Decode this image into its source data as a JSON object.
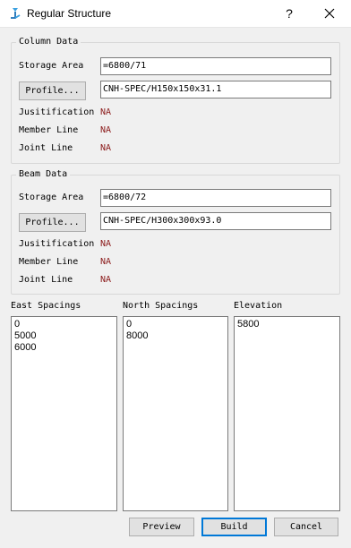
{
  "window": {
    "title": "Regular Structure",
    "help_label": "?",
    "close_label": "✕"
  },
  "column": {
    "group_title": "Column Data",
    "storage_label": "Storage Area",
    "storage_value": "=6800/71",
    "profile_button": "Profile...",
    "profile_value": "CNH-SPEC/H150x150x31.1",
    "justification_label": "Jusitification",
    "justification_value": "NA",
    "member_line_label": "Member Line",
    "member_line_value": "NA",
    "joint_line_label": "Joint Line",
    "joint_line_value": "NA"
  },
  "beam": {
    "group_title": "Beam Data",
    "storage_label": "Storage Area",
    "storage_value": "=6800/72",
    "profile_button": "Profile...",
    "profile_value": "CNH-SPEC/H300x300x93.0",
    "justification_label": "Jusitification",
    "justification_value": "NA",
    "member_line_label": "Member Line",
    "member_line_value": "NA",
    "joint_line_label": "Joint Line",
    "joint_line_value": "NA"
  },
  "spacings": {
    "east_label": "East Spacings",
    "east_items": [
      "0",
      "5000",
      "6000"
    ],
    "north_label": "North Spacings",
    "north_items": [
      "0",
      "8000"
    ],
    "elevation_label": "Elevation",
    "elevation_items": [
      "5800"
    ]
  },
  "buttons": {
    "preview": "Preview",
    "build": "Build",
    "cancel": "Cancel"
  },
  "colors": {
    "accent": "#0078d7",
    "na_text": "#8b1a1a"
  }
}
